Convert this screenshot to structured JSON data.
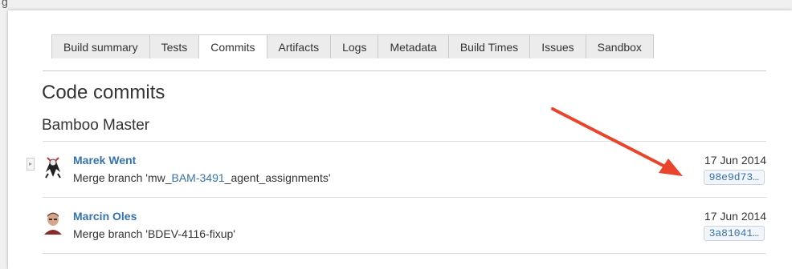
{
  "top_label": "g",
  "tabs": [
    {
      "label": "Build summary",
      "active": false
    },
    {
      "label": "Tests",
      "active": false
    },
    {
      "label": "Commits",
      "active": true
    },
    {
      "label": "Artifacts",
      "active": false
    },
    {
      "label": "Logs",
      "active": false
    },
    {
      "label": "Metadata",
      "active": false
    },
    {
      "label": "Build Times",
      "active": false
    },
    {
      "label": "Issues",
      "active": false
    },
    {
      "label": "Sandbox",
      "active": false
    }
  ],
  "page_title": "Code commits",
  "section_title": "Bamboo Master",
  "commits": [
    {
      "author": "Marek Went",
      "message_prefix": "Merge branch 'mw_",
      "message_link": "BAM-3491",
      "message_suffix": "_agent_assignments'",
      "date": "17 Jun 2014",
      "hash": "98e9d73…"
    },
    {
      "author": "Marcin Oles",
      "message_prefix": "Merge branch 'BDEV-4116-fixup'",
      "message_link": "",
      "message_suffix": "",
      "date": "17 Jun 2014",
      "hash": "3a81041…"
    }
  ],
  "colors": {
    "link": "#3572b0",
    "arrow": "#e8452c"
  },
  "icons": {
    "expander": "chevron-right-icon",
    "avatar_1": "user-avatar",
    "avatar_2": "user-avatar"
  }
}
